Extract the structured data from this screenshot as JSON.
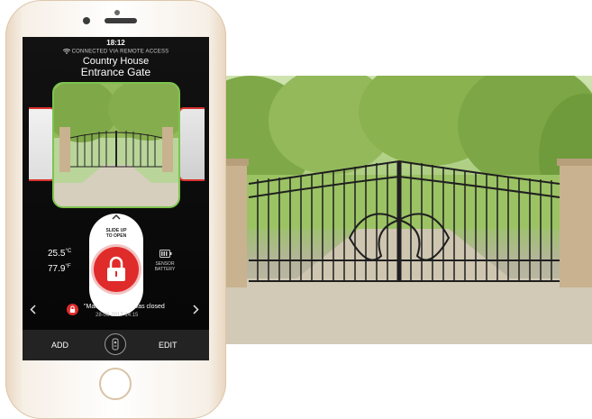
{
  "status_bar": {
    "time": "18:12",
    "connection": "CONNECTED VIA REMOTE ACCESS"
  },
  "header": {
    "location": "Country House",
    "gate_name": "Entrance Gate"
  },
  "unlock": {
    "slide_label_line1": "SLIDE UP",
    "slide_label_line2": "TO OPEN"
  },
  "sensors": {
    "temp_c": "25.5",
    "unit_c": "°C",
    "temp_f": "77.9",
    "unit_f": "°F",
    "battery_label_line1": "SENSOR",
    "battery_label_line2": "BATTERY"
  },
  "event": {
    "message": "\"Main Door\" door was closed",
    "datetime": "28-06-2017 14:15"
  },
  "bottom_bar": {
    "add_label": "ADD",
    "edit_label": "EDIT"
  },
  "colors": {
    "active_border": "#7dc44f",
    "inactive_border": "#d8332f",
    "lock_red": "#e02b2b"
  }
}
